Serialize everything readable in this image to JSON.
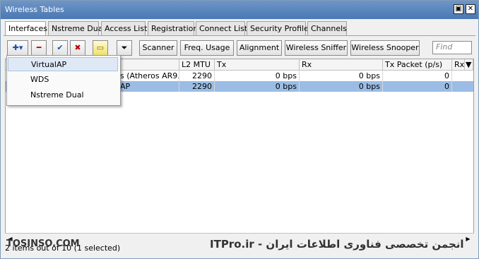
{
  "window": {
    "title": "Wireless Tables",
    "restore_glyph": "▣",
    "close_glyph": "✕"
  },
  "tabs": [
    "Interfaces",
    "Nstreme Dual",
    "Access List",
    "Registration",
    "Connect List",
    "Security Profiles",
    "Channels"
  ],
  "toolbar": {
    "add_glyph": "✚▾",
    "remove_glyph": "━",
    "enable_glyph": "✔",
    "disable_glyph": "✖",
    "comment_glyph": "▭",
    "filter_glyph": "⏷",
    "scanner": "Scanner",
    "freq_usage": "Freq. Usage",
    "alignment": "Alignment",
    "wireless_sniffer": "Wireless Sniffer",
    "wireless_snooper": "Wireless Snooper",
    "find_placeholder": "Find"
  },
  "table": {
    "headers": [
      "L2 MTU",
      "Tx",
      "Rx",
      "Tx Packet (p/s)",
      "Rx"
    ],
    "sort_glyph": "▼",
    "rows": [
      {
        "name": "s (Atheros AR9...",
        "l2mtu": "2290",
        "tx": "0 bps",
        "rx": "0 bps",
        "txp": "0",
        "selected": false
      },
      {
        "name": "AP",
        "l2mtu": "2290",
        "tx": "0 bps",
        "rx": "0 bps",
        "txp": "0",
        "selected": true
      }
    ]
  },
  "add_menu": [
    "VirtualAP",
    "WDS",
    "Nstreme Dual"
  ],
  "status": "2 items out of 10 (1 selected)",
  "watermark_left": "TOSINSO.COM",
  "watermark_right": "انجمن تخصصی فناوری اطلاعات ایران - ITPro.ir",
  "scroll_left_glyph": "◀",
  "scroll_right_glyph": "▶"
}
